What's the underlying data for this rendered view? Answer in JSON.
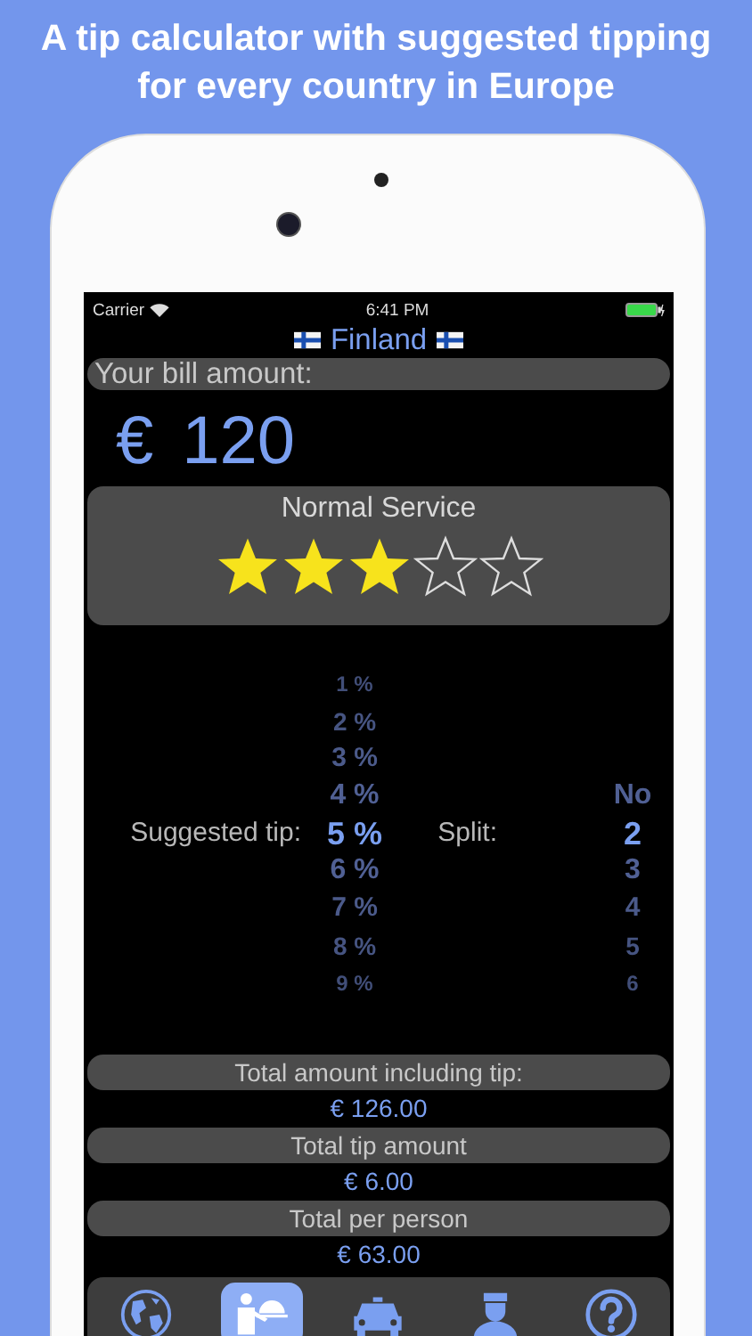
{
  "headline": "A tip calculator with suggested tipping for every country in Europe",
  "status_bar": {
    "carrier": "Carrier",
    "time": "6:41 PM"
  },
  "country": {
    "name": "Finland"
  },
  "bill": {
    "label": "Your bill amount:",
    "currency": "€",
    "amount": "120"
  },
  "service": {
    "label": "Normal Service",
    "stars": 3
  },
  "tip": {
    "label": "Suggested tip:",
    "options": [
      {
        "label": "1 %",
        "selected": false
      },
      {
        "label": "2 %",
        "selected": false
      },
      {
        "label": "3 %",
        "selected": false
      },
      {
        "label": "4 %",
        "selected": false
      },
      {
        "label": "5 %",
        "selected": true
      },
      {
        "label": "6 %",
        "selected": false
      },
      {
        "label": "7 %",
        "selected": false
      },
      {
        "label": "8 %",
        "selected": false
      },
      {
        "label": "9 %",
        "selected": false
      }
    ]
  },
  "split": {
    "label": "Split:",
    "options": [
      {
        "label": "No",
        "selected": false
      },
      {
        "label": "2",
        "selected": true
      },
      {
        "label": "3",
        "selected": false
      },
      {
        "label": "4",
        "selected": false
      },
      {
        "label": "5",
        "selected": false
      },
      {
        "label": "6",
        "selected": false
      }
    ]
  },
  "totals": [
    {
      "label": "Total amount including tip:",
      "value": "€ 126.00"
    },
    {
      "label": "Total tip amount",
      "value": "€ 6.00"
    },
    {
      "label": "Total per person",
      "value": "€ 63.00"
    }
  ],
  "tabs": [
    {
      "kind": "globe",
      "selected": false
    },
    {
      "kind": "waiter",
      "selected": true
    },
    {
      "kind": "taxi",
      "selected": false
    },
    {
      "kind": "porter",
      "selected": false
    },
    {
      "kind": "help",
      "selected": false
    }
  ]
}
